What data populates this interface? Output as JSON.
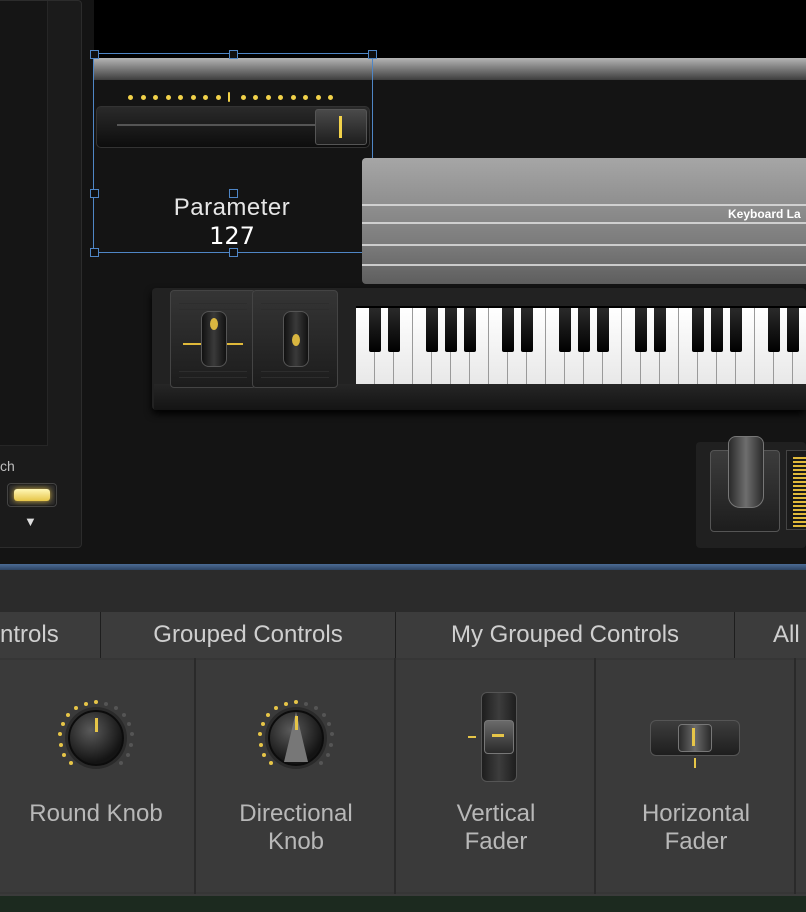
{
  "left_panel": {
    "label": "ch",
    "arrow": "▼"
  },
  "parameter": {
    "name": "Parameter",
    "value": "127"
  },
  "keyboard": {
    "label": "Keyboard La"
  },
  "library": {
    "tabs": [
      "ntrols",
      "Grouped Controls",
      "My Grouped Controls",
      "All"
    ],
    "items": [
      {
        "line1": "Round Knob",
        "line2": "",
        "icon": "round-knob-icon"
      },
      {
        "line1": "Directional",
        "line2": "Knob",
        "icon": "directional-knob-icon"
      },
      {
        "line1": "Vertical",
        "line2": "Fader",
        "icon": "vertical-fader-icon"
      },
      {
        "line1": "Horizontal",
        "line2": "Fader",
        "icon": "horizontal-fader-icon"
      }
    ]
  },
  "colors": {
    "accent_yellow": "#f2d24a",
    "selection_blue": "#4f86c6",
    "separator_blue": "#4b6b95"
  }
}
